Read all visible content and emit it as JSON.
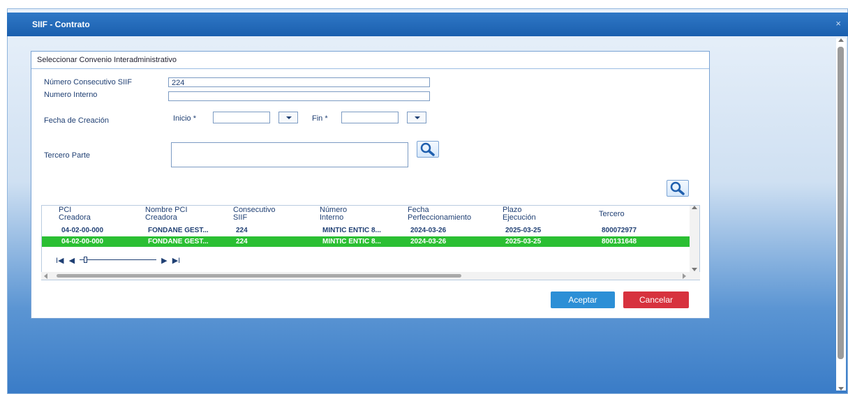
{
  "window": {
    "title": "SIIF - Contrato",
    "close_label": "×"
  },
  "panel": {
    "title": "Seleccionar Convenio Interadministrativo"
  },
  "form": {
    "consecutivo_label": "Número Consecutivo SIIF",
    "consecutivo_value": "224",
    "interno_label": "Numero Interno",
    "interno_value": "",
    "fecha_label": "Fecha de Creación",
    "inicio_label": "Inicio *",
    "inicio_value": "",
    "fin_label": "Fin *",
    "fin_value": "",
    "tercero_label": "Tercero Parte"
  },
  "table": {
    "headers": [
      {
        "line1": "PCI",
        "line2": "Creadora"
      },
      {
        "line1": "Nombre PCI",
        "line2": "Creadora"
      },
      {
        "line1": "Consecutivo",
        "line2": "SIIF"
      },
      {
        "line1": "Número",
        "line2": "Interno"
      },
      {
        "line1": "Fecha",
        "line2": "Perfeccionamiento"
      },
      {
        "line1": "Plazo",
        "line2": "Ejecución"
      },
      {
        "line1": "Tercero",
        "line2": ""
      }
    ],
    "rows": [
      {
        "pci": "04-02-00-000",
        "nombre": "FONDANE GEST...",
        "consecutivo": "224",
        "interno": "MINTIC ENTIC 8...",
        "fecha": "2024-03-26",
        "plazo": "2025-03-25",
        "tercero": "800072977"
      },
      {
        "pci": "04-02-00-000",
        "nombre": "FONDANE GEST...",
        "consecutivo": "224",
        "interno": "MINTIC ENTIC 8...",
        "fecha": "2024-03-26",
        "plazo": "2025-03-25",
        "tercero": "800131648"
      }
    ],
    "pager": {
      "first": "I◀",
      "prev": "◀",
      "next": "▶",
      "last": "▶I"
    }
  },
  "buttons": {
    "accept": "Aceptar",
    "cancel": "Cancelar"
  },
  "colors": {
    "selected_row": "#2bbf33",
    "accept": "#2c8fd6",
    "cancel": "#d7323e",
    "titlebar": "#1b5fae"
  }
}
